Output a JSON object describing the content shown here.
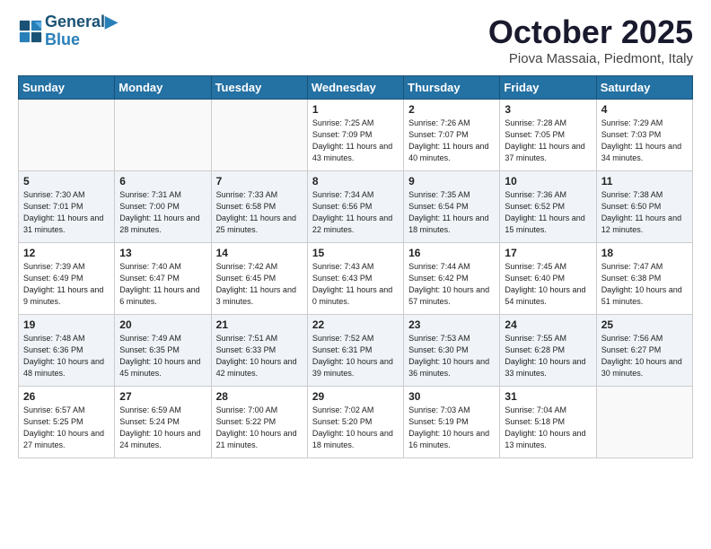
{
  "header": {
    "logo_line1": "General",
    "logo_line2": "Blue",
    "month": "October 2025",
    "location": "Piova Massaia, Piedmont, Italy"
  },
  "weekdays": [
    "Sunday",
    "Monday",
    "Tuesday",
    "Wednesday",
    "Thursday",
    "Friday",
    "Saturday"
  ],
  "weeks": [
    [
      {
        "day": "",
        "info": ""
      },
      {
        "day": "",
        "info": ""
      },
      {
        "day": "",
        "info": ""
      },
      {
        "day": "1",
        "info": "Sunrise: 7:25 AM\nSunset: 7:09 PM\nDaylight: 11 hours\nand 43 minutes."
      },
      {
        "day": "2",
        "info": "Sunrise: 7:26 AM\nSunset: 7:07 PM\nDaylight: 11 hours\nand 40 minutes."
      },
      {
        "day": "3",
        "info": "Sunrise: 7:28 AM\nSunset: 7:05 PM\nDaylight: 11 hours\nand 37 minutes."
      },
      {
        "day": "4",
        "info": "Sunrise: 7:29 AM\nSunset: 7:03 PM\nDaylight: 11 hours\nand 34 minutes."
      }
    ],
    [
      {
        "day": "5",
        "info": "Sunrise: 7:30 AM\nSunset: 7:01 PM\nDaylight: 11 hours\nand 31 minutes."
      },
      {
        "day": "6",
        "info": "Sunrise: 7:31 AM\nSunset: 7:00 PM\nDaylight: 11 hours\nand 28 minutes."
      },
      {
        "day": "7",
        "info": "Sunrise: 7:33 AM\nSunset: 6:58 PM\nDaylight: 11 hours\nand 25 minutes."
      },
      {
        "day": "8",
        "info": "Sunrise: 7:34 AM\nSunset: 6:56 PM\nDaylight: 11 hours\nand 22 minutes."
      },
      {
        "day": "9",
        "info": "Sunrise: 7:35 AM\nSunset: 6:54 PM\nDaylight: 11 hours\nand 18 minutes."
      },
      {
        "day": "10",
        "info": "Sunrise: 7:36 AM\nSunset: 6:52 PM\nDaylight: 11 hours\nand 15 minutes."
      },
      {
        "day": "11",
        "info": "Sunrise: 7:38 AM\nSunset: 6:50 PM\nDaylight: 11 hours\nand 12 minutes."
      }
    ],
    [
      {
        "day": "12",
        "info": "Sunrise: 7:39 AM\nSunset: 6:49 PM\nDaylight: 11 hours\nand 9 minutes."
      },
      {
        "day": "13",
        "info": "Sunrise: 7:40 AM\nSunset: 6:47 PM\nDaylight: 11 hours\nand 6 minutes."
      },
      {
        "day": "14",
        "info": "Sunrise: 7:42 AM\nSunset: 6:45 PM\nDaylight: 11 hours\nand 3 minutes."
      },
      {
        "day": "15",
        "info": "Sunrise: 7:43 AM\nSunset: 6:43 PM\nDaylight: 11 hours\nand 0 minutes."
      },
      {
        "day": "16",
        "info": "Sunrise: 7:44 AM\nSunset: 6:42 PM\nDaylight: 10 hours\nand 57 minutes."
      },
      {
        "day": "17",
        "info": "Sunrise: 7:45 AM\nSunset: 6:40 PM\nDaylight: 10 hours\nand 54 minutes."
      },
      {
        "day": "18",
        "info": "Sunrise: 7:47 AM\nSunset: 6:38 PM\nDaylight: 10 hours\nand 51 minutes."
      }
    ],
    [
      {
        "day": "19",
        "info": "Sunrise: 7:48 AM\nSunset: 6:36 PM\nDaylight: 10 hours\nand 48 minutes."
      },
      {
        "day": "20",
        "info": "Sunrise: 7:49 AM\nSunset: 6:35 PM\nDaylight: 10 hours\nand 45 minutes."
      },
      {
        "day": "21",
        "info": "Sunrise: 7:51 AM\nSunset: 6:33 PM\nDaylight: 10 hours\nand 42 minutes."
      },
      {
        "day": "22",
        "info": "Sunrise: 7:52 AM\nSunset: 6:31 PM\nDaylight: 10 hours\nand 39 minutes."
      },
      {
        "day": "23",
        "info": "Sunrise: 7:53 AM\nSunset: 6:30 PM\nDaylight: 10 hours\nand 36 minutes."
      },
      {
        "day": "24",
        "info": "Sunrise: 7:55 AM\nSunset: 6:28 PM\nDaylight: 10 hours\nand 33 minutes."
      },
      {
        "day": "25",
        "info": "Sunrise: 7:56 AM\nSunset: 6:27 PM\nDaylight: 10 hours\nand 30 minutes."
      }
    ],
    [
      {
        "day": "26",
        "info": "Sunrise: 6:57 AM\nSunset: 5:25 PM\nDaylight: 10 hours\nand 27 minutes."
      },
      {
        "day": "27",
        "info": "Sunrise: 6:59 AM\nSunset: 5:24 PM\nDaylight: 10 hours\nand 24 minutes."
      },
      {
        "day": "28",
        "info": "Sunrise: 7:00 AM\nSunset: 5:22 PM\nDaylight: 10 hours\nand 21 minutes."
      },
      {
        "day": "29",
        "info": "Sunrise: 7:02 AM\nSunset: 5:20 PM\nDaylight: 10 hours\nand 18 minutes."
      },
      {
        "day": "30",
        "info": "Sunrise: 7:03 AM\nSunset: 5:19 PM\nDaylight: 10 hours\nand 16 minutes."
      },
      {
        "day": "31",
        "info": "Sunrise: 7:04 AM\nSunset: 5:18 PM\nDaylight: 10 hours\nand 13 minutes."
      },
      {
        "day": "",
        "info": ""
      }
    ]
  ]
}
